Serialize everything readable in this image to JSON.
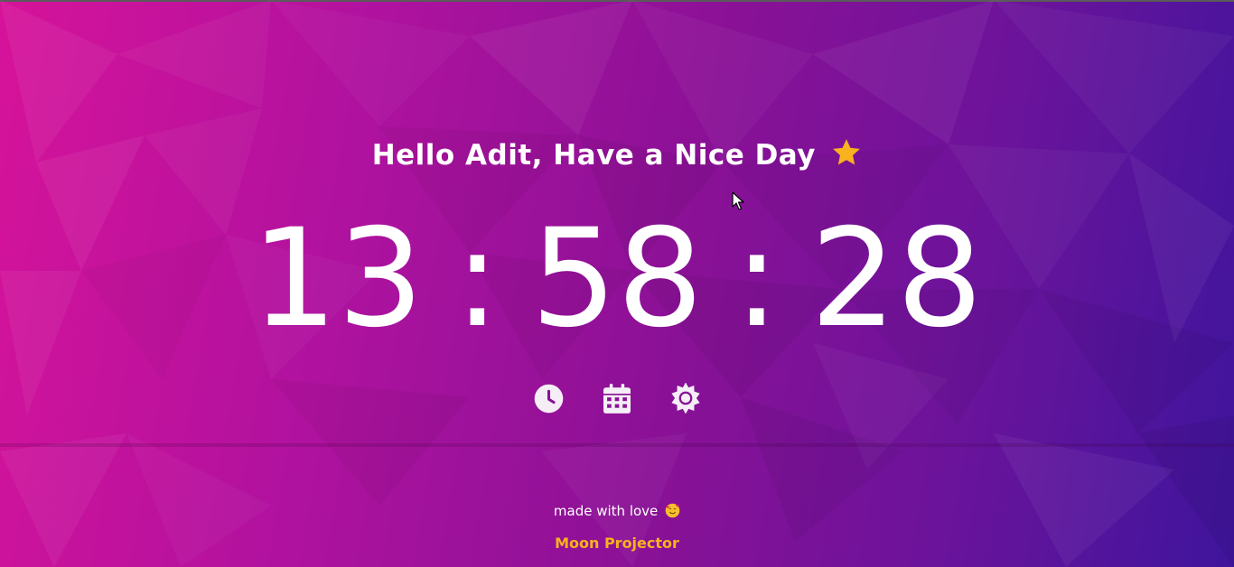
{
  "greeting": {
    "text": "Hello Adit, Have a Nice Day",
    "icon": "star-icon",
    "icon_color": "#f7b21e"
  },
  "clock": {
    "hours": "13",
    "minutes": "58",
    "seconds": "28",
    "separator": ":"
  },
  "controls": [
    {
      "icon": "clock-icon"
    },
    {
      "icon": "calendar-icon"
    },
    {
      "icon": "sun-icon"
    }
  ],
  "footer": {
    "made_with": "made with love",
    "made_with_icon": "smiling-face-with-hearts-icon",
    "brand": "Moon Projector",
    "brand_color": "#f7b21e"
  },
  "colors": {
    "background_start": "#d6139a",
    "background_end": "#3e159c",
    "text": "#ffffff"
  }
}
